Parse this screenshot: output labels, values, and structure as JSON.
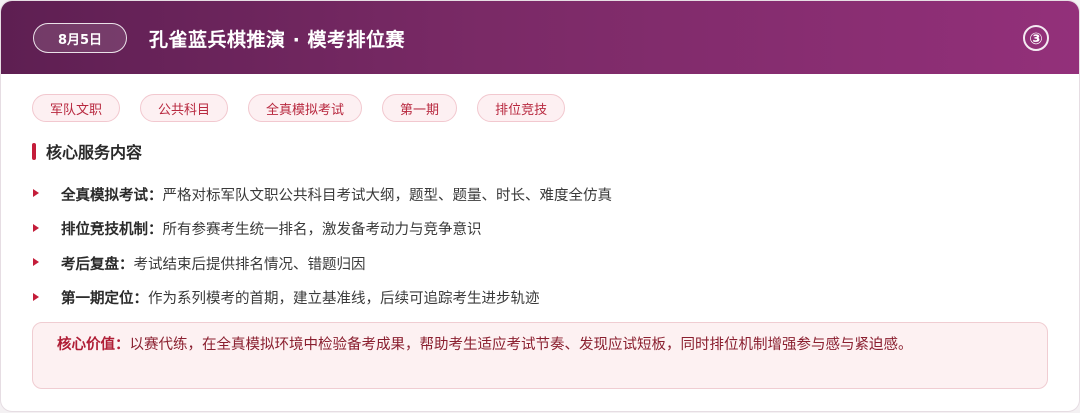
{
  "header": {
    "date": "8月5日",
    "title": "孔雀蓝兵棋推演 · 模考排位赛",
    "number_icon": "③"
  },
  "tags": [
    "军队文职",
    "公共科目",
    "全真模拟考试",
    "第一期",
    "排位竞技"
  ],
  "section": {
    "title": "核心服务内容",
    "items": [
      {
        "label": "全真模拟考试：",
        "text": "严格对标军队文职公共科目考试大纲，题型、题量、时长、难度全仿真"
      },
      {
        "label": "排位竞技机制：",
        "text": "所有参赛考生统一排名，激发备考动力与竞争意识"
      },
      {
        "label": "考后复盘：",
        "text": "考试结束后提供排名情况、错题归因"
      },
      {
        "label": "第一期定位：",
        "text": "作为系列模考的首期，建立基准线，后续可追踪考生进步轨迹"
      }
    ]
  },
  "value": {
    "label": "核心价值：",
    "text": "以赛代练，在全真模拟环境中检验备考成果，帮助考生适应考试节奏、发现应试短板，同时排位机制增强参与感与紧迫感。"
  },
  "colors": {
    "header_start": "#5e1f52",
    "header_end": "#93307a",
    "accent_red": "#c41d3a",
    "tag_bg": "#fdf0f2"
  }
}
